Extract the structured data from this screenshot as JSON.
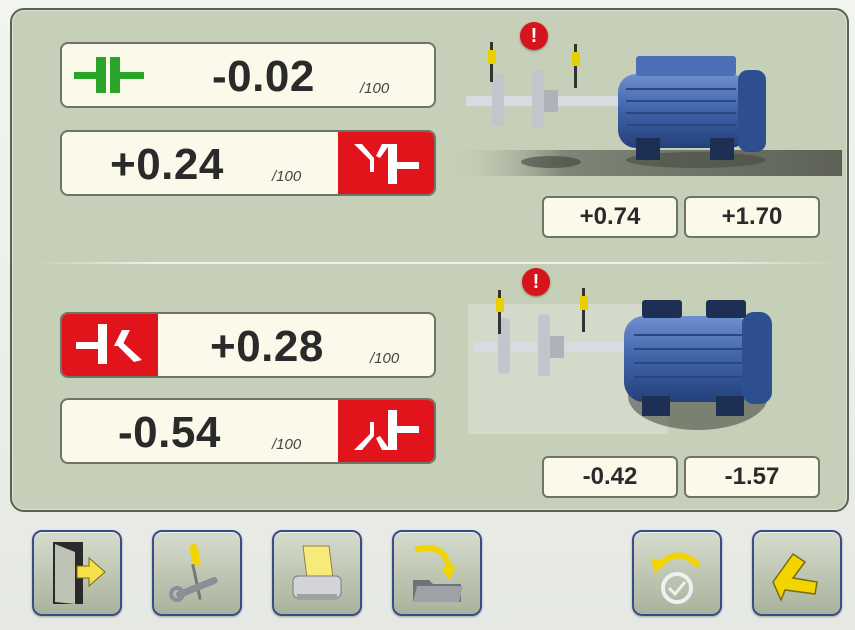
{
  "top": {
    "horizontal": {
      "value": "-0.02",
      "unit": "/100",
      "icon": "coupling-ok-icon",
      "status_color": "#2aa52a"
    },
    "angular": {
      "value": "+0.24",
      "unit": "/100",
      "icon": "angular-misalignment-icon",
      "status_color": "#e1141b"
    },
    "feet": [
      "+0.74",
      "+1.70"
    ]
  },
  "bottom": {
    "angular": {
      "value": "+0.28",
      "unit": "/100",
      "icon": "angular-misalignment-icon",
      "status_color": "#e1141b"
    },
    "offset": {
      "value": "-0.54",
      "unit": "/100",
      "icon": "offset-misalignment-icon",
      "status_color": "#e1141b"
    },
    "feet": [
      "-0.42",
      "-1.57"
    ]
  },
  "warnings": {
    "symbol": "!"
  },
  "toolbar": [
    {
      "icon": "exit-door-icon"
    },
    {
      "icon": "tools-icon"
    },
    {
      "icon": "printer-icon"
    },
    {
      "icon": "save-folder-icon"
    },
    {
      "icon": "rotate-measure-icon"
    },
    {
      "icon": "shims-icon"
    }
  ],
  "colors": {
    "panel": "#c6cfb7",
    "alert": "#e1141b",
    "ok": "#2aa52a",
    "motor": "#3f62a8"
  }
}
